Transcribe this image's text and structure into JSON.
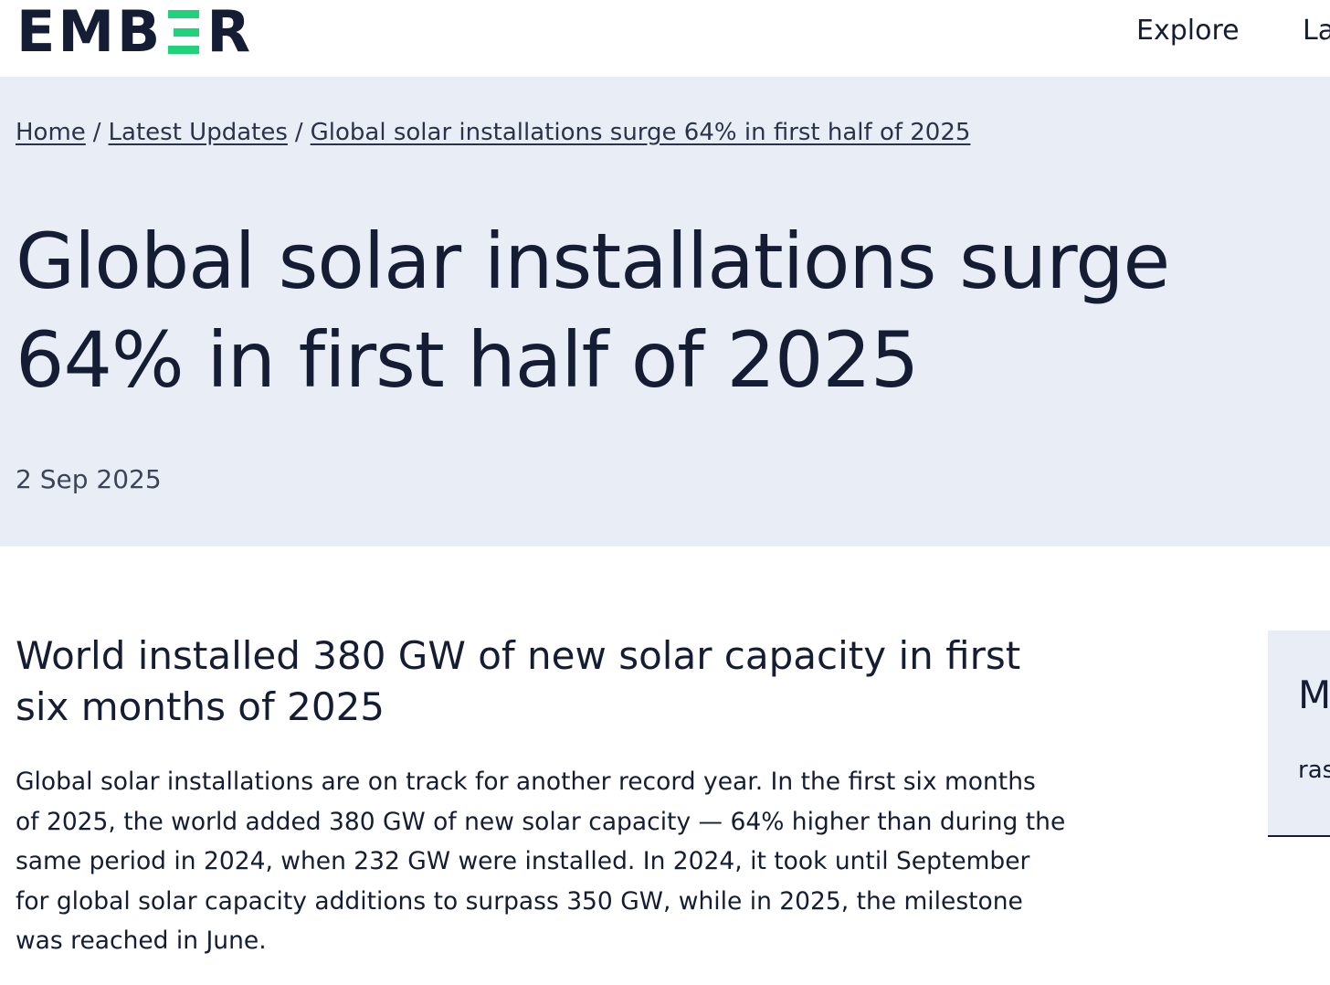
{
  "header": {
    "logo_left": "EMB",
    "logo_right": "R",
    "nav": [
      "Explore",
      "La"
    ]
  },
  "breadcrumb": [
    "Home",
    "Latest Updates",
    "Global solar installations surge 64% in first half of 2025"
  ],
  "article": {
    "title": "Global solar installations surge 64% in first half of 2025",
    "date": "2 Sep 2025",
    "subheading": "World installed 380 GW of new solar capacity in first six months of 2025",
    "body": "Global solar installations are on track for another record year. In the first six months of 2025, the world added 380 GW of new solar capacity — 64% higher than during the same period in 2024, when 232 GW were installed. In 2024, it took until September for global solar capacity additions to surpass 350 GW, while in 2025, the milestone was reached in June."
  },
  "side_card": {
    "title": "M",
    "text": "ras"
  },
  "colors": {
    "brand_dark": "#141d33",
    "brand_green": "#1fd37a",
    "hero_bg": "#e9eef6"
  }
}
